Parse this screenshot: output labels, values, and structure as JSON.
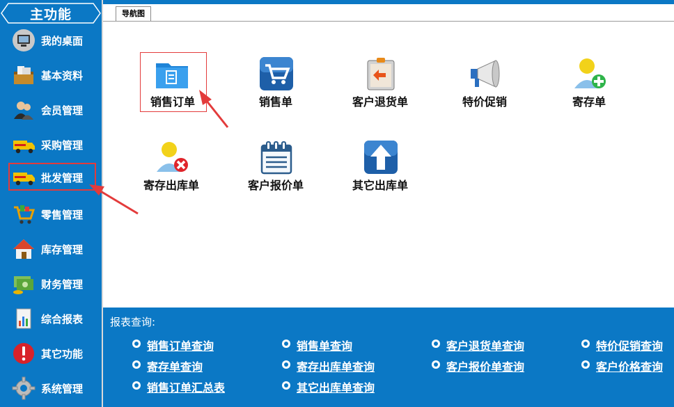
{
  "sidebar": {
    "title": "主功能",
    "items": [
      {
        "label": "我的桌面",
        "icon": "desktop-icon"
      },
      {
        "label": "基本资料",
        "icon": "archive-box-icon"
      },
      {
        "label": "会员管理",
        "icon": "members-icon"
      },
      {
        "label": "采购管理",
        "icon": "delivery-truck-icon"
      },
      {
        "label": "批发管理",
        "icon": "delivery-truck-icon",
        "active": true
      },
      {
        "label": "零售管理",
        "icon": "shopping-cart-icon"
      },
      {
        "label": "库存管理",
        "icon": "house-icon"
      },
      {
        "label": "财务管理",
        "icon": "money-icon"
      },
      {
        "label": "综合报表",
        "icon": "report-chart-icon"
      },
      {
        "label": "其它功能",
        "icon": "exclamation-icon"
      },
      {
        "label": "系统管理",
        "icon": "gear-icon"
      }
    ]
  },
  "tab": {
    "label": "导航图"
  },
  "apps": [
    {
      "label": "销售订单",
      "icon": "folder-document-icon",
      "selected": true
    },
    {
      "label": "销售单",
      "icon": "shopping-cart-icon"
    },
    {
      "label": "客户退货单",
      "icon": "return-clipboard-icon"
    },
    {
      "label": "特价促销",
      "icon": "megaphone-icon"
    },
    {
      "label": "寄存单",
      "icon": "user-add-icon"
    },
    {
      "label": "寄存出库单",
      "icon": "user-remove-icon"
    },
    {
      "label": "客户报价单",
      "icon": "calendar-notepad-icon"
    },
    {
      "label": "其它出库单",
      "icon": "up-arrow-icon"
    }
  ],
  "report": {
    "title": "报表查询:",
    "links": [
      "销售订单查询",
      "销售单查询",
      "客户退货单查询",
      "特价促销查询",
      "寄存单查询",
      "寄存出库单查询",
      "客户报价单查询",
      "客户价格查询",
      "销售订单汇总表",
      "其它出库单查询"
    ]
  },
  "colors": {
    "sidebar_bg": "#0b78c5",
    "highlight": "#e33b3b",
    "text_light": "#ffffff"
  }
}
